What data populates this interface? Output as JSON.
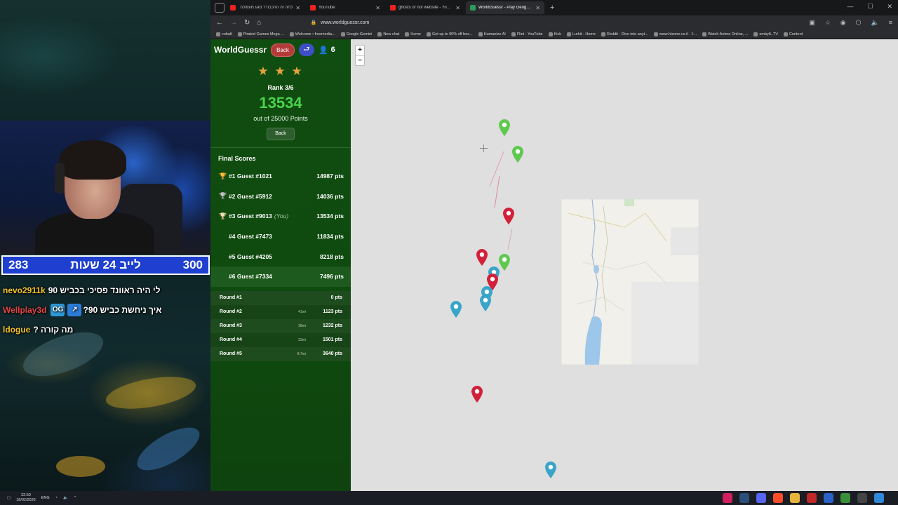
{
  "stream": {
    "goal_left": "283",
    "goal_label": "לייב 24 שעות",
    "goal_right": "300",
    "chat": [
      {
        "user": "nevo2911k",
        "emote": "",
        "message": "לי היה ראוונד פסיכי בכביש 90"
      },
      {
        "user": "Wellplay3d",
        "emote": "OG",
        "message": "איך ניחשת כביש 90?"
      },
      {
        "user": "ldogue",
        "emote": "",
        "message": "מה קורה ?"
      }
    ]
  },
  "browser": {
    "tabs": [
      {
        "title": "לחה זה ההכבורר מגע מעפולה",
        "icon": "youtube-icon",
        "active": false
      },
      {
        "title": "YouTube",
        "icon": "youtube-icon",
        "active": false
      },
      {
        "title": "ghosts or not website - YouTube",
        "icon": "youtube-icon",
        "active": false
      },
      {
        "title": "WorldGuessr - Play Geoguessr Free",
        "icon": "worldguessr-icon",
        "active": true
      }
    ],
    "new_tab": "+",
    "url": "www.worldguessr.com",
    "bookmarks": [
      "cobalt",
      "Pirated Games Mega ...",
      "Welcome • freemedia...",
      "Google Gemini",
      "New chat",
      "Home",
      "Get up to 90% off bes...",
      "Humanize AI",
      "Flint - YouTube",
      "Kick",
      "Lurkit - Home",
      "Reddit - Dive into anyt...",
      "www.htzone.co.il - כ...",
      "Watch Anime Online, ...",
      "embyIL.TV",
      "Content"
    ]
  },
  "game": {
    "brand": "WorldGuessr",
    "back_label": "Back",
    "share_symbol": "⮐",
    "player_count": "6",
    "stars": "★ ★ ★",
    "rank": "Rank 3/6",
    "points": "13534",
    "out_of": "out of 25000 Points",
    "back2_label": "Back",
    "final_scores_title": "Final Scores",
    "players": [
      {
        "medal": "🏆",
        "name": "#1 Guest #1021",
        "you": "",
        "pts": "14987 pts"
      },
      {
        "medal": "🏆",
        "name": "#2 Guest #5912",
        "you": "",
        "pts": "14036 pts"
      },
      {
        "medal": "🏆",
        "name": "#3 Guest #9013",
        "you": "(You)",
        "pts": "13534 pts"
      },
      {
        "medal": "",
        "name": "#4 Guest #7473",
        "you": "",
        "pts": "11834 pts"
      },
      {
        "medal": "",
        "name": "#5 Guest #4205",
        "you": "",
        "pts": "8218 pts"
      },
      {
        "medal": "",
        "name": "#6 Guest #7334",
        "you": "",
        "pts": "7496 pts"
      }
    ],
    "rounds": [
      {
        "name": "Round #1",
        "dist": "",
        "pts": "0 pts"
      },
      {
        "name": "Round #2",
        "dist": "41mi",
        "pts": "1123 pts"
      },
      {
        "name": "Round #3",
        "dist": "38mi",
        "pts": "1232 pts"
      },
      {
        "name": "Round #4",
        "dist": "33mi",
        "pts": "1501 pts"
      },
      {
        "name": "Round #5",
        "dist": "8.7mi",
        "pts": "3640 pts"
      }
    ],
    "zoom_in": "+",
    "zoom_out": "−",
    "pin_colors": {
      "guess": "#d3203a",
      "answer": "#5fc94f",
      "other": "#39a5c9"
    }
  },
  "taskbar": {
    "lang": "ENG",
    "time": "22:50",
    "date": "18/02/2026"
  }
}
